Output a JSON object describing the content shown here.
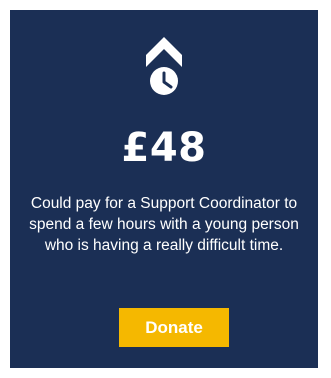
{
  "card": {
    "icon": "chevron-up-clock-icon",
    "amount": "£48",
    "description": "Could pay for a Support Coordinator to spend a few hours with a young person who is having a really difficult time.",
    "button_label": "Donate"
  },
  "colors": {
    "card_background": "#1b2f55",
    "text": "#ffffff",
    "button_background": "#f5b800"
  }
}
